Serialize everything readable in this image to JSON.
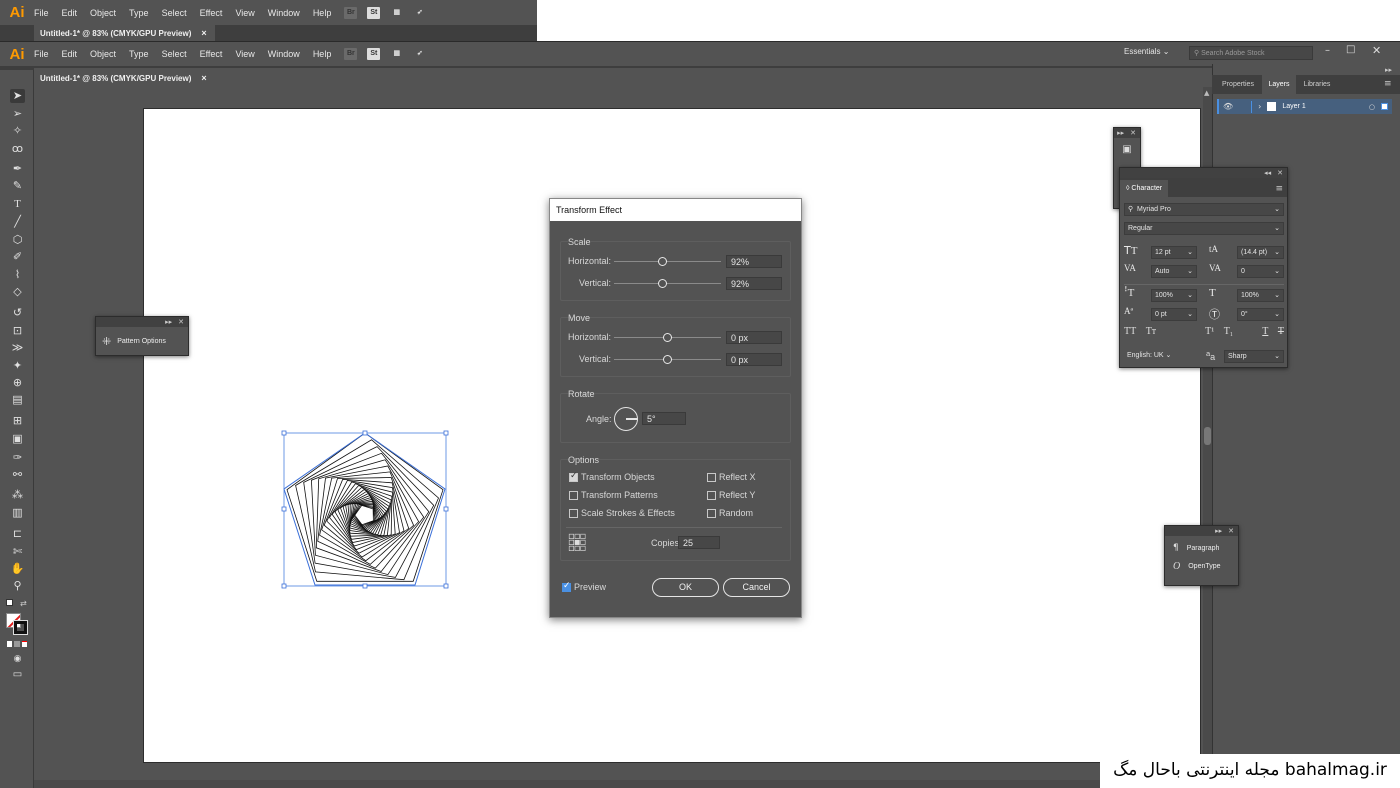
{
  "app": {
    "logo": "Ai",
    "menus": [
      "File",
      "Edit",
      "Object",
      "Type",
      "Select",
      "Effect",
      "View",
      "Window",
      "Help"
    ],
    "bridge": "Br",
    "stock": "St"
  },
  "document": {
    "tab_title": "Untitled-1* @ 83% (CMYK/GPU Preview)",
    "close": "×"
  },
  "header": {
    "workspace": "Essentials",
    "search_placeholder": "Search Adobe Stock"
  },
  "right_panel": {
    "tabs": [
      "Properties",
      "Layers",
      "Libraries"
    ],
    "layer_name": "Layer 1"
  },
  "pattern_panel": {
    "label": "Pattern Options"
  },
  "dialog": {
    "title": "Transform Effect",
    "scale": {
      "label": "Scale",
      "h_label": "Horizontal:",
      "h_value": "92%",
      "v_label": "Vertical:",
      "v_value": "92%"
    },
    "move": {
      "label": "Move",
      "h_label": "Horizontal:",
      "h_value": "0 px",
      "v_label": "Vertical:",
      "v_value": "0 px"
    },
    "rotate": {
      "label": "Rotate",
      "angle_label": "Angle:",
      "angle_value": "5°"
    },
    "options": {
      "label": "Options",
      "transform_objects": "Transform Objects",
      "transform_patterns": "Transform Patterns",
      "scale_strokes": "Scale Strokes & Effects",
      "reflect_x": "Reflect X",
      "reflect_y": "Reflect Y",
      "random": "Random",
      "copies_label": "Copies",
      "copies_value": "25"
    },
    "preview": "Preview",
    "ok": "OK",
    "cancel": "Cancel"
  },
  "character": {
    "title": "Character",
    "font": "Myriad Pro",
    "style": "Regular",
    "size": "12 pt",
    "leading": "(14.4 pt)",
    "kerning": "Auto",
    "tracking": "0",
    "vscale": "100%",
    "hscale": "100%",
    "baseline": "0 pt",
    "rotation": "0°",
    "language": "English: UK",
    "aa": "Sharp",
    "glyph_a": "a",
    "glyph_aa": "a"
  },
  "para_panel": {
    "paragraph": "Paragraph",
    "opentype": "OpenType"
  },
  "watermark": "مجله اینترنتی باحال مگ bahalmag.ir"
}
